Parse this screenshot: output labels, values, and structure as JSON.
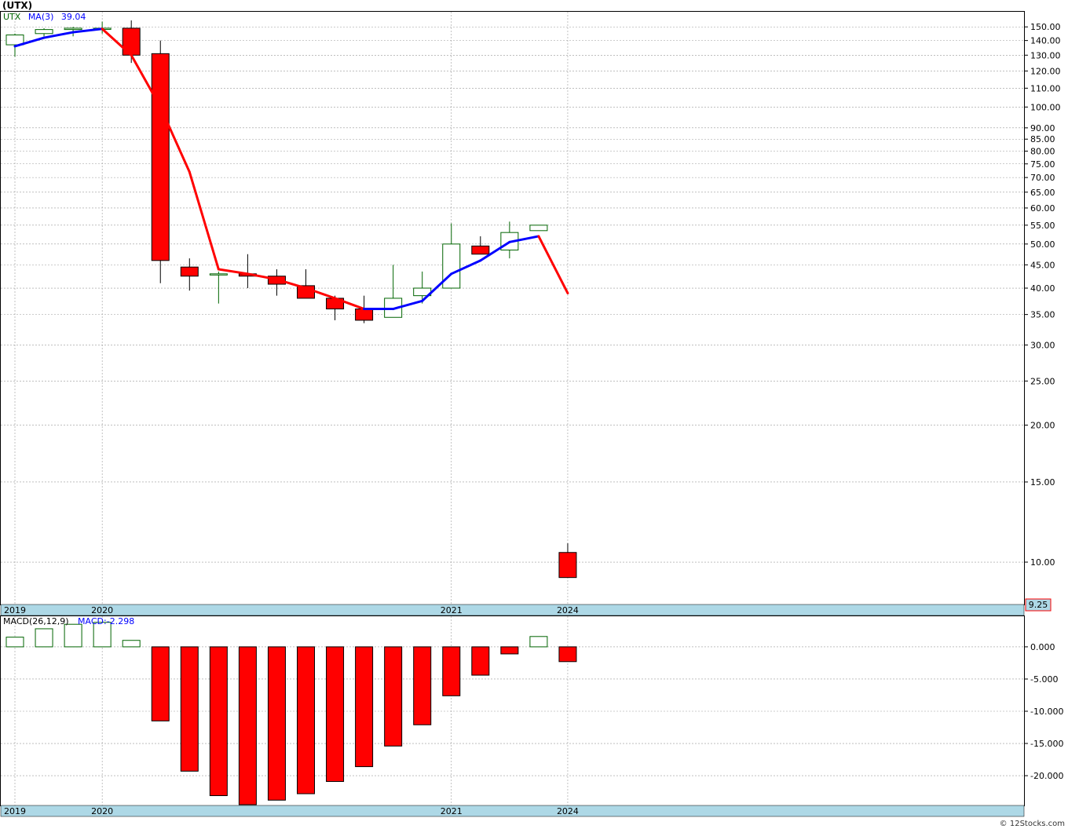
{
  "title": "(UTX)",
  "legend": {
    "symbol": "UTX",
    "ma_label": "MA(3)",
    "ma_value": "39.04"
  },
  "macd_legend": {
    "label": "MACD(26,12,9)",
    "value": "MACD:-2.298"
  },
  "last_price_label": "9.25",
  "footer": "© 12Stocks.com",
  "colors": {
    "up": "#006400",
    "down": "#ff0000",
    "ma_up": "#0000ff",
    "ma_down": "#ff0000",
    "axis_band": "#add8e6"
  },
  "chart_data": [
    {
      "type": "candlestick",
      "scale": "log",
      "ylim": [
        8.2,
        160
      ],
      "y_ticks": [
        "150.00",
        "140.00",
        "130.00",
        "120.00",
        "110.00",
        "100.00",
        "90.00",
        "85.00",
        "80.00",
        "75.00",
        "70.00",
        "65.00",
        "60.00",
        "55.00",
        "50.00",
        "45.00",
        "40.00",
        "35.00",
        "30.00",
        "25.00",
        "20.00",
        "15.00",
        "10.00"
      ],
      "x_labels": [
        {
          "label": "2019",
          "index": 0
        },
        {
          "label": "2020",
          "index": 3
        },
        {
          "label": "2021",
          "index": 15
        },
        {
          "label": "2024",
          "index": 19
        }
      ],
      "candles": [
        {
          "o": 137,
          "h": 145,
          "l": 129,
          "c": 144
        },
        {
          "o": 145,
          "h": 149,
          "l": 143,
          "c": 148
        },
        {
          "o": 148,
          "h": 150,
          "l": 143,
          "c": 149
        },
        {
          "o": 149,
          "h": 154,
          "l": 145,
          "c": 149
        },
        {
          "o": 149,
          "h": 155,
          "l": 125,
          "c": 130
        },
        {
          "o": 131,
          "h": 140,
          "l": 41,
          "c": 46
        },
        {
          "o": 44.5,
          "h": 46.5,
          "l": 39.5,
          "c": 42.5
        },
        {
          "o": 43,
          "h": 43.5,
          "l": 37,
          "c": 43
        },
        {
          "o": 43,
          "h": 47.5,
          "l": 40,
          "c": 42.5
        },
        {
          "o": 42.5,
          "h": 44,
          "l": 38.5,
          "c": 40.8
        },
        {
          "o": 40.5,
          "h": 44,
          "l": 38,
          "c": 38
        },
        {
          "o": 38,
          "h": 38.5,
          "l": 34,
          "c": 36
        },
        {
          "o": 36,
          "h": 38.5,
          "l": 33.5,
          "c": 34
        },
        {
          "o": 34.5,
          "h": 45,
          "l": 34.5,
          "c": 38
        },
        {
          "o": 38.5,
          "h": 43.5,
          "l": 37,
          "c": 40
        },
        {
          "o": 40,
          "h": 55.5,
          "l": 40,
          "c": 50
        },
        {
          "o": 49.5,
          "h": 52,
          "l": 47.5,
          "c": 47.5
        },
        {
          "o": 48.5,
          "h": 56,
          "l": 46.5,
          "c": 53
        },
        {
          "o": 53.5,
          "h": 55,
          "l": 53.5,
          "c": 55
        },
        {
          "o": 10.5,
          "h": 11,
          "l": 9.25,
          "c": 9.25
        }
      ],
      "ma": [
        136,
        142,
        146,
        148.5,
        130,
        100,
        72,
        44,
        43,
        41.8,
        40,
        38,
        36,
        36,
        37.5,
        43,
        46,
        50.5,
        52,
        39
      ]
    },
    {
      "type": "bar",
      "name": "MACD(26,12,9)",
      "ylim": [
        -24.5,
        4.5
      ],
      "y_ticks": [
        "0.000",
        "-5.000",
        "-10.000",
        "-15.000",
        "-20.000"
      ],
      "values": [
        1.5,
        2.8,
        3.5,
        3.8,
        1.0,
        -11.5,
        -19.3,
        -23.1,
        -24.5,
        -23.8,
        -22.8,
        -20.9,
        -18.6,
        -15.4,
        -12.1,
        -7.6,
        -4.4,
        -1.1,
        1.6,
        -2.298
      ]
    }
  ]
}
